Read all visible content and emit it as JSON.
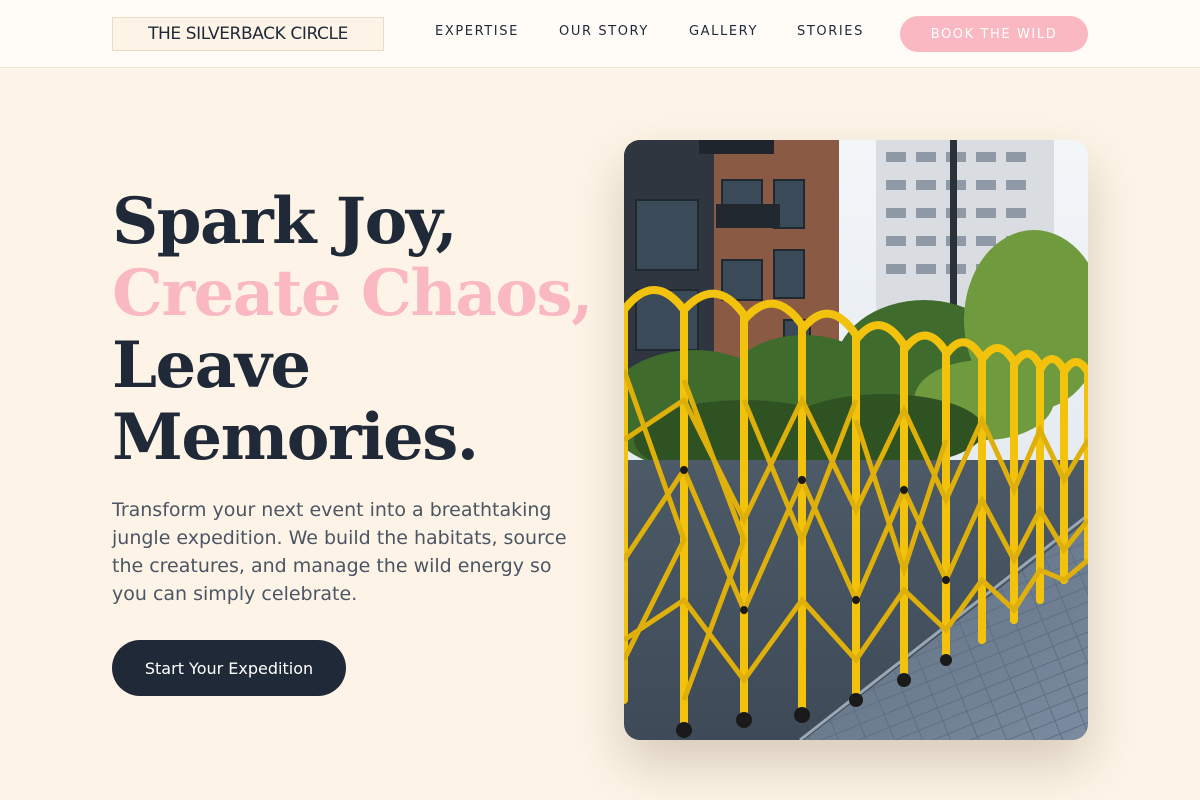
{
  "header": {
    "logo_text": "THE SILVERBACK CIRCLE",
    "nav": [
      {
        "label": "EXPERTISE"
      },
      {
        "label": "OUR STORY"
      },
      {
        "label": "GALLERY"
      },
      {
        "label": "STORIES"
      }
    ],
    "cta_label": "BOOK THE WILD"
  },
  "hero": {
    "headline": {
      "line1": "Spark Joy,",
      "line2": "Create Chaos,",
      "line3": "Leave",
      "line4": "Memories."
    },
    "description": "Transform your next event into a breathtaking jungle expedition. We build the habitats, source the creatures, and manage the wild energy so you can simply celebrate.",
    "button_label": "Start Your Expedition",
    "image_subject": "yellow-folding-barriers-city-street-photo"
  },
  "colors": {
    "page_background": "#fdf4e7",
    "header_background": "#fffcf8",
    "text_dark": "#1f2937",
    "accent_pink": "#f9b8c2",
    "body_gray": "#4b5563",
    "barrier_yellow": "#f2c20d"
  }
}
